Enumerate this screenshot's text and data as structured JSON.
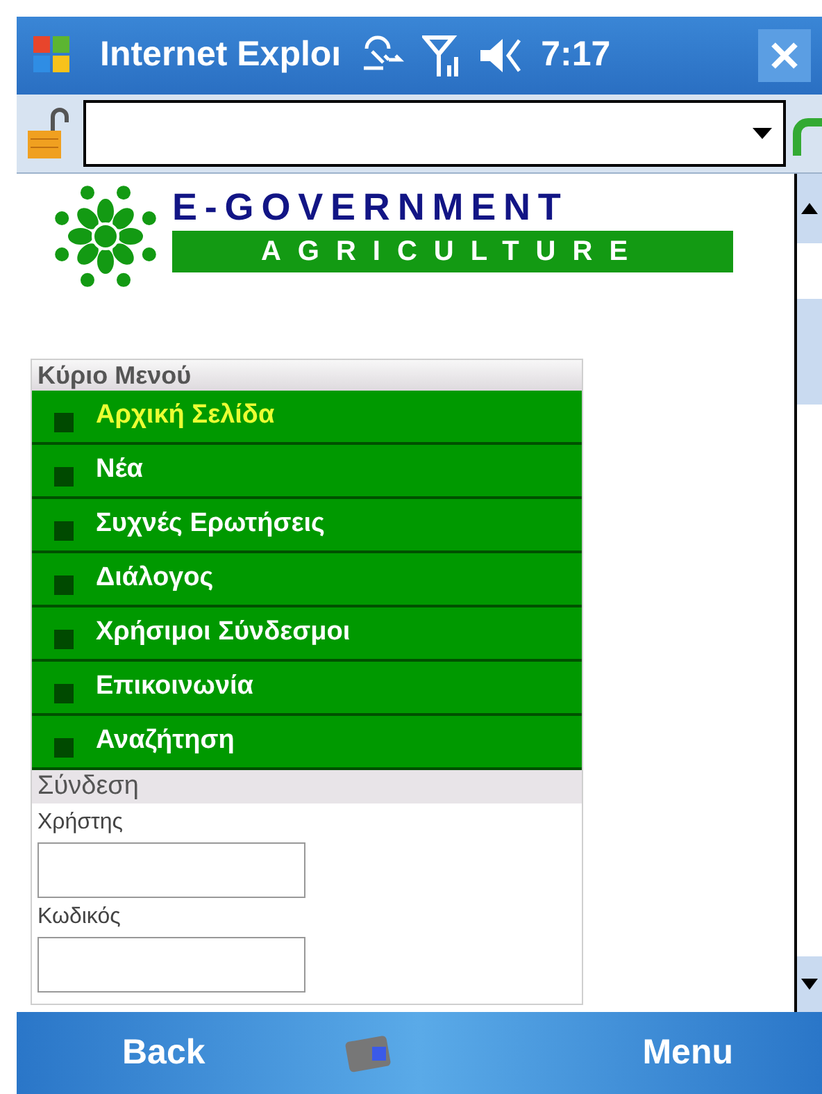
{
  "title_bar": {
    "title": "Internet Exploı",
    "time": "7:17"
  },
  "logo": {
    "title": "E-GOVERNMENT",
    "subtitle": "AGRICULTURE"
  },
  "main_menu": {
    "heading": "Κύριο Μενού",
    "items": [
      {
        "label": "Αρχική Σελίδα",
        "selected": true
      },
      {
        "label": "Νέα",
        "selected": false
      },
      {
        "label": "Συχνές Ερωτήσεις",
        "selected": false
      },
      {
        "label": "Διάλογος",
        "selected": false
      },
      {
        "label": "Χρήσιμοι Σύνδεσμοι",
        "selected": false
      },
      {
        "label": "Επικοινωνία",
        "selected": false
      },
      {
        "label": "Αναζήτηση",
        "selected": false
      }
    ]
  },
  "login": {
    "heading": "Σύνδεση",
    "fields": [
      {
        "label": "Χρήστης"
      },
      {
        "label": "Κωδικός"
      }
    ]
  },
  "softkeys": {
    "left": "Back",
    "right": "Menu"
  }
}
